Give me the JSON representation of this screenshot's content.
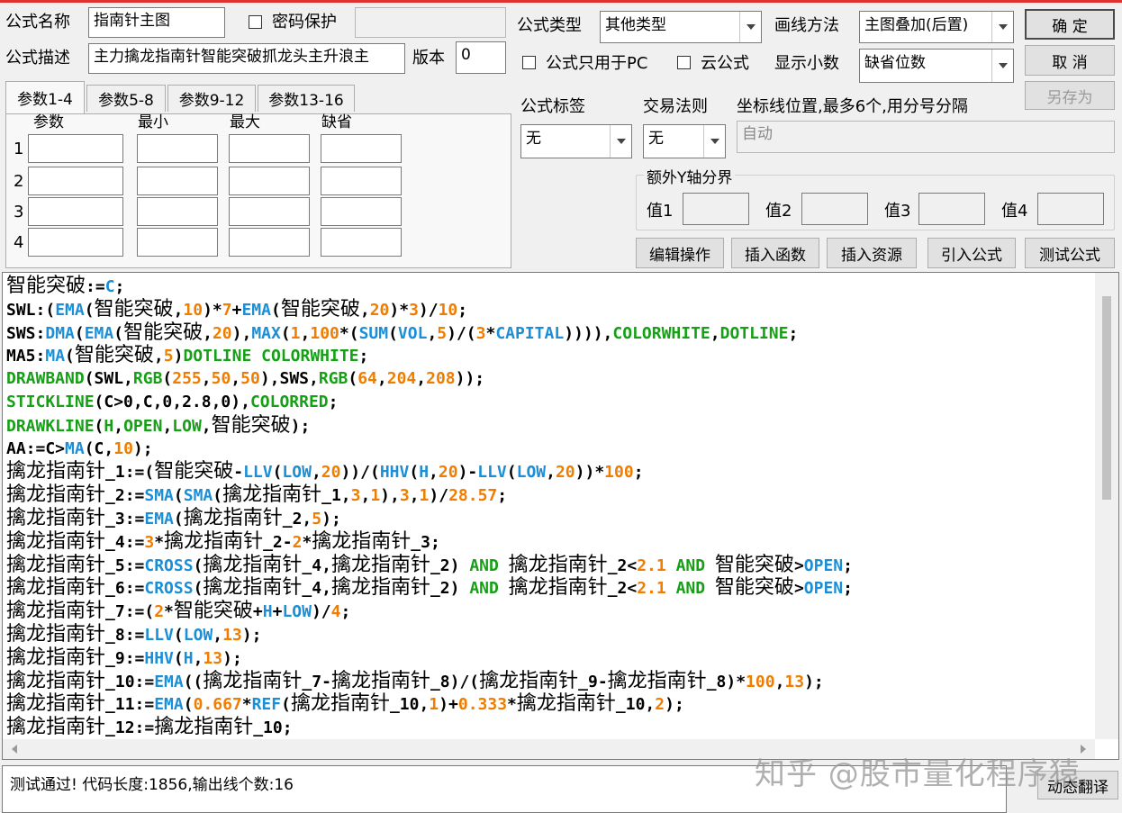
{
  "top_bar_color": "#e03030",
  "form": {
    "name_label": "公式名称",
    "name_value": "指南针主图",
    "password_label": "密码保护",
    "desc_label": "公式描述",
    "desc_value": "主力擒龙指南针智能突破抓龙头主升浪主",
    "version_label": "版本",
    "version_value": "0",
    "type_label": "公式类型",
    "type_value": "其他类型",
    "draw_label": "画线方法",
    "draw_value": "主图叠加(后置)",
    "pc_only_label": "公式只用于PC",
    "cloud_label": "云公式",
    "decimal_label": "显示小数",
    "decimal_value": "缺省位数",
    "tag_label": "公式标签",
    "tag_value": "无",
    "rule_label": "交易法则",
    "rule_value": "无",
    "axis_label": "坐标线位置,最多6个,用分号分隔",
    "axis_value": "自动",
    "yaxis_group": "额外Y轴分界",
    "y_values": [
      "值1",
      "值2",
      "值3",
      "值4"
    ]
  },
  "buttons": {
    "ok": "确  定",
    "cancel": "取  消",
    "save_as": "另存为",
    "edit_ops": "编辑操作",
    "insert_func": "插入函数",
    "insert_res": "插入资源",
    "import_formula": "引入公式",
    "test_formula": "测试公式",
    "dynamic_translate": "动态翻译"
  },
  "tabs": [
    "参数1-4",
    "参数5-8",
    "参数9-12",
    "参数13-16"
  ],
  "param_headers": [
    "参数",
    "最小",
    "最大",
    "缺省"
  ],
  "param_rows": [
    "1",
    "2",
    "3",
    "4"
  ],
  "code_colors": {
    "default": "#000000",
    "function": "#1a8fd8",
    "number": "#f07d00",
    "keyword": "#15a016"
  },
  "code_lines": [
    [
      [
        "t",
        "智能突破"
      ],
      [
        "d",
        ":="
      ],
      [
        "f",
        "C"
      ],
      [
        "d",
        ";"
      ]
    ],
    [
      [
        "d",
        "SWL:("
      ],
      [
        "f",
        "EMA"
      ],
      [
        "d",
        "("
      ],
      [
        "t",
        "智能突破"
      ],
      [
        "d",
        ","
      ],
      [
        "n",
        "10"
      ],
      [
        "d",
        ")*"
      ],
      [
        "n",
        "7"
      ],
      [
        "d",
        "+"
      ],
      [
        "f",
        "EMA"
      ],
      [
        "d",
        "("
      ],
      [
        "t",
        "智能突破"
      ],
      [
        "d",
        ","
      ],
      [
        "n",
        "20"
      ],
      [
        "d",
        ")*"
      ],
      [
        "n",
        "3"
      ],
      [
        "d",
        ")/"
      ],
      [
        "n",
        "10"
      ],
      [
        "d",
        ";"
      ]
    ],
    [
      [
        "d",
        "SWS:"
      ],
      [
        "f",
        "DMA"
      ],
      [
        "d",
        "("
      ],
      [
        "f",
        "EMA"
      ],
      [
        "d",
        "("
      ],
      [
        "t",
        "智能突破"
      ],
      [
        "d",
        ","
      ],
      [
        "n",
        "20"
      ],
      [
        "d",
        "),"
      ],
      [
        "f",
        "MAX"
      ],
      [
        "d",
        "("
      ],
      [
        "n",
        "1"
      ],
      [
        "d",
        ","
      ],
      [
        "n",
        "100"
      ],
      [
        "d",
        "*("
      ],
      [
        "f",
        "SUM"
      ],
      [
        "d",
        "("
      ],
      [
        "f",
        "VOL"
      ],
      [
        "d",
        ","
      ],
      [
        "n",
        "5"
      ],
      [
        "d",
        ")/("
      ],
      [
        "n",
        "3"
      ],
      [
        "d",
        "*"
      ],
      [
        "f",
        "CAPITAL"
      ],
      [
        "d",
        "))))"
      ],
      [
        "d",
        ","
      ],
      [
        "k",
        "COLORWHITE"
      ],
      [
        "d",
        ","
      ],
      [
        "k",
        "DOTLINE"
      ],
      [
        "d",
        ";"
      ]
    ],
    [
      [
        "d",
        "MA5:"
      ],
      [
        "f",
        "MA"
      ],
      [
        "d",
        "("
      ],
      [
        "t",
        "智能突破"
      ],
      [
        "d",
        ","
      ],
      [
        "n",
        "5"
      ],
      [
        "d",
        ")"
      ],
      [
        "k",
        "DOTLINE COLORWHITE"
      ],
      [
        "d",
        ";"
      ]
    ],
    [
      [
        "k",
        "DRAWBAND"
      ],
      [
        "d",
        "(SWL,"
      ],
      [
        "k",
        "RGB"
      ],
      [
        "d",
        "("
      ],
      [
        "n",
        "255"
      ],
      [
        "d",
        ","
      ],
      [
        "n",
        "50"
      ],
      [
        "d",
        ","
      ],
      [
        "n",
        "50"
      ],
      [
        "d",
        "),SWS,"
      ],
      [
        "k",
        "RGB"
      ],
      [
        "d",
        "("
      ],
      [
        "n",
        "64"
      ],
      [
        "d",
        ","
      ],
      [
        "n",
        "204"
      ],
      [
        "d",
        ","
      ],
      [
        "n",
        "208"
      ],
      [
        "d",
        "));"
      ]
    ],
    [
      [
        "k",
        "STICKLINE"
      ],
      [
        "d",
        "(C>0,C,0,2.8,0),"
      ],
      [
        "k",
        "COLORRED"
      ],
      [
        "d",
        ";"
      ]
    ],
    [
      [
        "k",
        "DRAWKLINE"
      ],
      [
        "d",
        "("
      ],
      [
        "k",
        "H"
      ],
      [
        "d",
        ","
      ],
      [
        "k",
        "OPEN"
      ],
      [
        "d",
        ","
      ],
      [
        "k",
        "LOW"
      ],
      [
        "d",
        ","
      ],
      [
        "t",
        "智能突破"
      ],
      [
        "d",
        ");"
      ]
    ],
    [
      [
        "d",
        "AA:=C>"
      ],
      [
        "f",
        "MA"
      ],
      [
        "d",
        "(C,"
      ],
      [
        "n",
        "10"
      ],
      [
        "d",
        ");"
      ]
    ],
    [
      [
        "t",
        "擒龙指南针"
      ],
      [
        "d",
        "_1:=("
      ],
      [
        "t",
        "智能突破"
      ],
      [
        "d",
        "-"
      ],
      [
        "f",
        "LLV"
      ],
      [
        "d",
        "("
      ],
      [
        "f",
        "LOW"
      ],
      [
        "d",
        ","
      ],
      [
        "n",
        "20"
      ],
      [
        "d",
        "))/("
      ],
      [
        "f",
        "HHV"
      ],
      [
        "d",
        "("
      ],
      [
        "f",
        "H"
      ],
      [
        "d",
        ","
      ],
      [
        "n",
        "20"
      ],
      [
        "d",
        ")-"
      ],
      [
        "f",
        "LLV"
      ],
      [
        "d",
        "("
      ],
      [
        "f",
        "LOW"
      ],
      [
        "d",
        ","
      ],
      [
        "n",
        "20"
      ],
      [
        "d",
        "))*"
      ],
      [
        "n",
        "100"
      ],
      [
        "d",
        ";"
      ]
    ],
    [
      [
        "t",
        "擒龙指南针"
      ],
      [
        "d",
        "_2:="
      ],
      [
        "f",
        "SMA"
      ],
      [
        "d",
        "("
      ],
      [
        "f",
        "SMA"
      ],
      [
        "d",
        "("
      ],
      [
        "t",
        "擒龙指南针"
      ],
      [
        "d",
        "_1,"
      ],
      [
        "n",
        "3"
      ],
      [
        "d",
        ","
      ],
      [
        "n",
        "1"
      ],
      [
        "d",
        "),"
      ],
      [
        "n",
        "3"
      ],
      [
        "d",
        ","
      ],
      [
        "n",
        "1"
      ],
      [
        "d",
        ")/"
      ],
      [
        "n",
        "28.57"
      ],
      [
        "d",
        ";"
      ]
    ],
    [
      [
        "t",
        "擒龙指南针"
      ],
      [
        "d",
        "_3:="
      ],
      [
        "f",
        "EMA"
      ],
      [
        "d",
        "("
      ],
      [
        "t",
        "擒龙指南针"
      ],
      [
        "d",
        "_2,"
      ],
      [
        "n",
        "5"
      ],
      [
        "d",
        ");"
      ]
    ],
    [
      [
        "t",
        "擒龙指南针"
      ],
      [
        "d",
        "_4:="
      ],
      [
        "n",
        "3"
      ],
      [
        "d",
        "*"
      ],
      [
        "t",
        "擒龙指南针"
      ],
      [
        "d",
        "_2-"
      ],
      [
        "n",
        "2"
      ],
      [
        "d",
        "*"
      ],
      [
        "t",
        "擒龙指南针"
      ],
      [
        "d",
        "_3;"
      ]
    ],
    [
      [
        "t",
        "擒龙指南针"
      ],
      [
        "d",
        "_5:="
      ],
      [
        "f",
        "CROSS"
      ],
      [
        "d",
        "("
      ],
      [
        "t",
        "擒龙指南针"
      ],
      [
        "d",
        "_4,"
      ],
      [
        "t",
        "擒龙指南针"
      ],
      [
        "d",
        "_2) "
      ],
      [
        "k",
        "AND"
      ],
      [
        "d",
        " "
      ],
      [
        "t",
        "擒龙指南针"
      ],
      [
        "d",
        "_2<"
      ],
      [
        "n",
        "2.1"
      ],
      [
        "d",
        " "
      ],
      [
        "k",
        "AND"
      ],
      [
        "d",
        " "
      ],
      [
        "t",
        "智能突破"
      ],
      [
        "d",
        ">"
      ],
      [
        "f",
        "OPEN"
      ],
      [
        "d",
        ";"
      ]
    ],
    [
      [
        "t",
        "擒龙指南针"
      ],
      [
        "d",
        "_6:="
      ],
      [
        "f",
        "CROSS"
      ],
      [
        "d",
        "("
      ],
      [
        "t",
        "擒龙指南针"
      ],
      [
        "d",
        "_4,"
      ],
      [
        "t",
        "擒龙指南针"
      ],
      [
        "d",
        "_2) "
      ],
      [
        "k",
        "AND"
      ],
      [
        "d",
        " "
      ],
      [
        "t",
        "擒龙指南针"
      ],
      [
        "d",
        "_2<"
      ],
      [
        "n",
        "2.1"
      ],
      [
        "d",
        " "
      ],
      [
        "k",
        "AND"
      ],
      [
        "d",
        " "
      ],
      [
        "t",
        "智能突破"
      ],
      [
        "d",
        ">"
      ],
      [
        "f",
        "OPEN"
      ],
      [
        "d",
        ";"
      ]
    ],
    [
      [
        "t",
        "擒龙指南针"
      ],
      [
        "d",
        "_7:=("
      ],
      [
        "n",
        "2"
      ],
      [
        "d",
        "*"
      ],
      [
        "t",
        "智能突破"
      ],
      [
        "d",
        "+"
      ],
      [
        "f",
        "H"
      ],
      [
        "d",
        "+"
      ],
      [
        "f",
        "LOW"
      ],
      [
        "d",
        ")/"
      ],
      [
        "n",
        "4"
      ],
      [
        "d",
        ";"
      ]
    ],
    [
      [
        "t",
        "擒龙指南针"
      ],
      [
        "d",
        "_8:="
      ],
      [
        "f",
        "LLV"
      ],
      [
        "d",
        "("
      ],
      [
        "f",
        "LOW"
      ],
      [
        "d",
        ","
      ],
      [
        "n",
        "13"
      ],
      [
        "d",
        ");"
      ]
    ],
    [
      [
        "t",
        "擒龙指南针"
      ],
      [
        "d",
        "_9:="
      ],
      [
        "f",
        "HHV"
      ],
      [
        "d",
        "("
      ],
      [
        "f",
        "H"
      ],
      [
        "d",
        ","
      ],
      [
        "n",
        "13"
      ],
      [
        "d",
        ");"
      ]
    ],
    [
      [
        "t",
        "擒龙指南针"
      ],
      [
        "d",
        "_10:="
      ],
      [
        "f",
        "EMA"
      ],
      [
        "d",
        "(("
      ],
      [
        "t",
        "擒龙指南针"
      ],
      [
        "d",
        "_7-"
      ],
      [
        "t",
        "擒龙指南针"
      ],
      [
        "d",
        "_8)/("
      ],
      [
        "t",
        "擒龙指南针"
      ],
      [
        "d",
        "_9-"
      ],
      [
        "t",
        "擒龙指南针"
      ],
      [
        "d",
        "_8)*"
      ],
      [
        "n",
        "100"
      ],
      [
        "d",
        ","
      ],
      [
        "n",
        "13"
      ],
      [
        "d",
        ");"
      ]
    ],
    [
      [
        "t",
        "擒龙指南针"
      ],
      [
        "d",
        "_11:="
      ],
      [
        "f",
        "EMA"
      ],
      [
        "d",
        "("
      ],
      [
        "n",
        "0.667"
      ],
      [
        "d",
        "*"
      ],
      [
        "f",
        "REF"
      ],
      [
        "d",
        "("
      ],
      [
        "t",
        "擒龙指南针"
      ],
      [
        "d",
        "_10,"
      ],
      [
        "n",
        "1"
      ],
      [
        "d",
        ")+"
      ],
      [
        "n",
        "0.333"
      ],
      [
        "d",
        "*"
      ],
      [
        "t",
        "擒龙指南针"
      ],
      [
        "d",
        "_10,"
      ],
      [
        "n",
        "2"
      ],
      [
        "d",
        ");"
      ]
    ],
    [
      [
        "t",
        "擒龙指南针"
      ],
      [
        "d",
        "_12:="
      ],
      [
        "t",
        "擒龙指南针"
      ],
      [
        "d",
        "_10;"
      ]
    ]
  ],
  "status_text": "测试通过! 代码长度:1856,输出线个数:16",
  "watermark": "知乎 @股市量化程序猿"
}
